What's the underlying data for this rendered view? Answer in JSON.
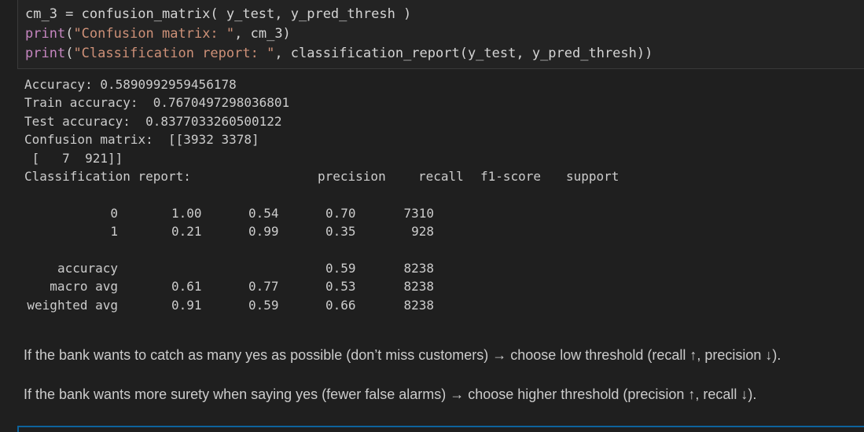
{
  "code": {
    "line1": "cm_3 = confusion_matrix( y_test, y_pred_thresh )",
    "line2": {
      "fn": "print",
      "open": "(",
      "str": "\"Confusion matrix: \"",
      "rest": ", cm_3)"
    },
    "line3": {
      "fn": "print",
      "open": "(",
      "str": "\"Classification report: \"",
      "rest": ", classification_report(y_test, y_pred_thresh))"
    }
  },
  "output": {
    "accuracy": "Accuracy: 0.5890992959456178",
    "train_accuracy": "Train accuracy:  0.7670497298036801",
    "test_accuracy": "Test accuracy:  0.8377033260500122",
    "cm_line1": "Confusion matrix:  [[3932 3378]",
    "cm_line2": " [   7  921]]",
    "report_label": "Classification report: ",
    "headers": [
      "precision",
      "recall",
      "f1-score",
      "support"
    ],
    "rows": [
      {
        "label": "0",
        "values": [
          "1.00",
          "0.54",
          "0.70",
          "7310"
        ]
      },
      {
        "label": "1",
        "values": [
          "0.21",
          "0.99",
          "0.35",
          "928"
        ]
      }
    ],
    "summary_rows": [
      {
        "label": "accuracy",
        "values": [
          "",
          "",
          "0.59",
          "8238"
        ]
      },
      {
        "label": "macro avg",
        "values": [
          "0.61",
          "0.77",
          "0.53",
          "8238"
        ]
      },
      {
        "label": "weighted avg",
        "values": [
          "0.91",
          "0.59",
          "0.66",
          "8238"
        ]
      }
    ]
  },
  "markdown": {
    "para1": "If the bank wants to catch as many yes as possible (don’t miss customers) → choose low threshold (recall ↑, precision ↓).",
    "para2": "If the bank wants more surety when saying yes (fewer false alarms) → choose higher threshold (precision ↑, recall ↓)."
  }
}
